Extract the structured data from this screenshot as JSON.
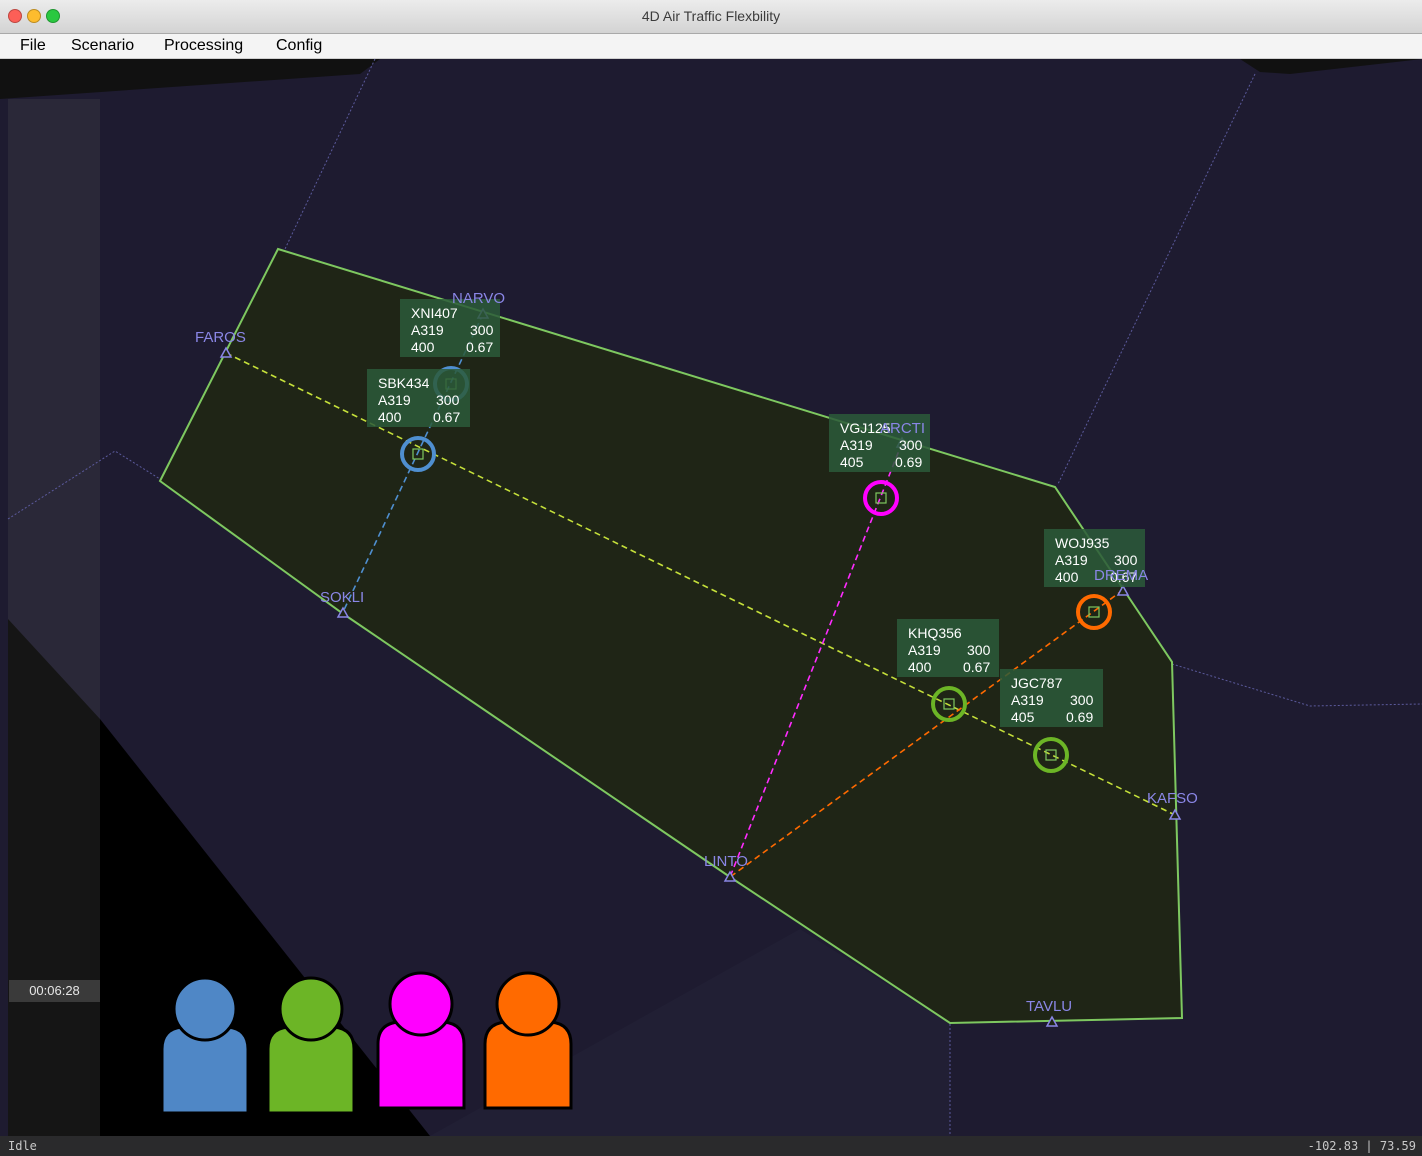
{
  "window": {
    "title": "4D Air Traffic Flexbility"
  },
  "menu": {
    "items": [
      "File",
      "Scenario",
      "Processing",
      "Config"
    ]
  },
  "waypoints": [
    {
      "name": "NARVO"
    },
    {
      "name": "FAROS"
    },
    {
      "name": "SOKLI"
    },
    {
      "name": "ARCTI"
    },
    {
      "name": "DREMA"
    },
    {
      "name": "KAFSO"
    },
    {
      "name": "LINTO"
    },
    {
      "name": "TAVLU"
    }
  ],
  "flights": [
    {
      "callsign": "XNI407",
      "type": "A319",
      "level": "300",
      "speed": "400",
      "value": "0.67",
      "color": "#4f8fd0"
    },
    {
      "callsign": "SBK434",
      "type": "A319",
      "level": "300",
      "speed": "400",
      "value": "0.67",
      "color": "#4f8fd0"
    },
    {
      "callsign": "VGJ125",
      "type": "A319",
      "level": "300",
      "speed": "405",
      "value": "0.69",
      "color": "#ff00ff"
    },
    {
      "callsign": "WOJ935",
      "type": "A319",
      "level": "300",
      "speed": "400",
      "value": "0.67",
      "color": "#ff6a00"
    },
    {
      "callsign": "KHQ356",
      "type": "A319",
      "level": "300",
      "speed": "400",
      "value": "0.67",
      "color": "#6cb526"
    },
    {
      "callsign": "JGC787",
      "type": "A319",
      "level": "300",
      "speed": "405",
      "value": "0.69",
      "color": "#6cb526"
    }
  ],
  "controllers": [
    {
      "name": "blue-controller",
      "color": "#4f87c6"
    },
    {
      "name": "green-controller",
      "color": "#6cb526"
    },
    {
      "name": "magenta-controller",
      "color": "#ff00ff"
    },
    {
      "name": "orange-controller",
      "color": "#ff6a00"
    }
  ],
  "colors": {
    "sector_fill": "#1f2516",
    "sector_border": "#7ec860",
    "waypoint": "#8a86e6",
    "route_default": "#c5e03a"
  },
  "clock": {
    "time": "00:06:28"
  },
  "status": {
    "state": "Idle",
    "coords": "-102.83 | 73.59"
  }
}
